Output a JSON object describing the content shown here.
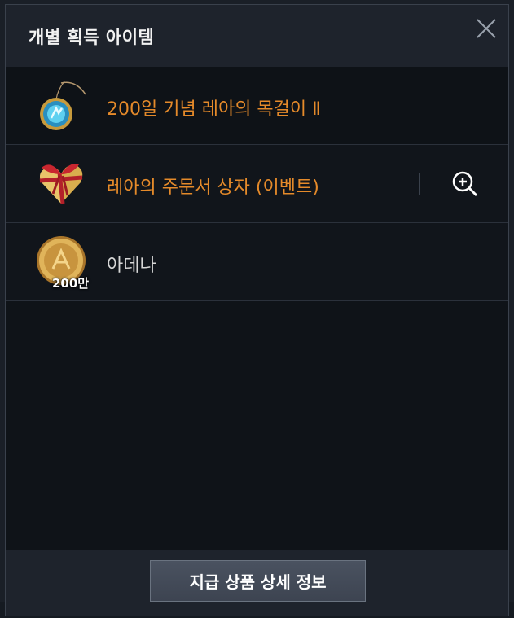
{
  "dialog": {
    "title": "개별 획득 아이템",
    "close_icon": "close-icon"
  },
  "items": [
    {
      "name": "200일 기념 레아의 목걸이 Ⅱ",
      "icon": "necklace-icon",
      "name_color": "#e58a2a"
    },
    {
      "name": "레아의 주문서 상자 (이벤트)",
      "icon": "gift-box-icon",
      "name_color": "#e58a2a",
      "action_icon": "zoom-in-icon"
    },
    {
      "name": "아데나",
      "icon": "coin-icon",
      "quantity": "200만",
      "name_color": "#d8d8d8"
    }
  ],
  "footer": {
    "detail_button_label": "지급 상품 상세 정보"
  }
}
